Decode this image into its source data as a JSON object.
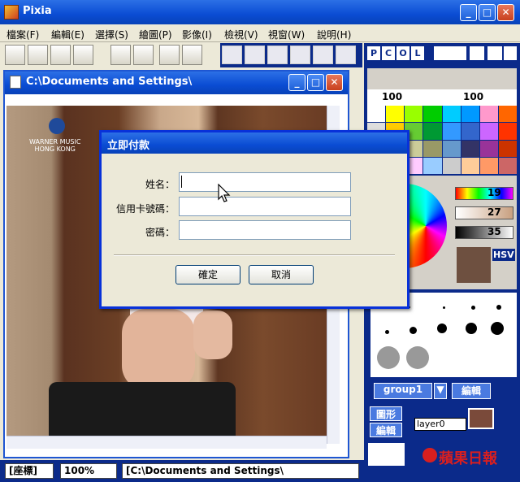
{
  "app": {
    "title": "Pixia"
  },
  "menu": [
    "檔案(F)",
    "編輯(E)",
    "選擇(S)",
    "繪圖(P)",
    "影像(I)",
    "檢視(V)",
    "視窗(W)",
    "說明(H)"
  ],
  "panel": {
    "pcol": [
      "P",
      "C",
      "O",
      "L"
    ],
    "size_value_1": "100",
    "size_value_2": "100",
    "slider_values": [
      "19",
      "27",
      "35"
    ],
    "hsv_label": "HSV",
    "group_name": "group1",
    "edit_button": "編輯",
    "shape_button": "圖形",
    "edit_button_2": "編輯",
    "layer_name": "layer0"
  },
  "document": {
    "title": "C:\\Documents and Settings\\"
  },
  "watermark": {
    "line1": "WARNER MUSIC",
    "line2": "HONG KONG"
  },
  "dialog": {
    "title": "立即付款",
    "name_label": "姓名：",
    "card_label": "信用卡號碼：",
    "password_label": "密碼：",
    "name_value": "",
    "card_value": "",
    "password_value": "",
    "ok_label": "確定",
    "cancel_label": "取消"
  },
  "statusbar": {
    "mode": "[座標]",
    "zoom": "100%",
    "path": "[C:\\Documents and Settings\\"
  },
  "brand": {
    "text": "蘋果日報"
  },
  "colors": {
    "titlebar": "#0a4cd3",
    "panel": "#0b2a8a",
    "dialog_bg": "#ece9d8",
    "brand": "#d91f1f"
  }
}
